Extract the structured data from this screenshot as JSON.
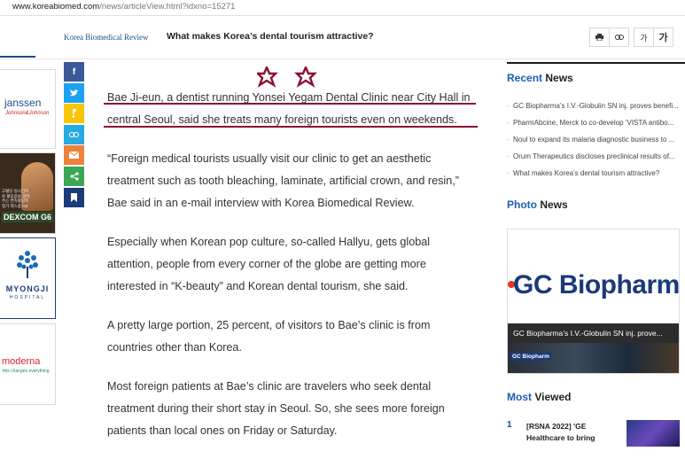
{
  "browser": {
    "url_host": "www.koreabiomed.com",
    "url_path": "/news/articleView.html?idxno=15271"
  },
  "header": {
    "brand": "Korea Biomedical Review",
    "headline": "What makes Korea’s dental tourism attractive?",
    "tools": {
      "print_icon": "printer-icon",
      "link_icon": "link-icon",
      "font_small": "가",
      "font_large": "가"
    }
  },
  "ads": {
    "janssen": {
      "name": "janssen",
      "sub": "Johnson&Johnson"
    },
    "dexcom": {
      "name": "DEXCOM G6",
      "blurb": "고혈당 실시간으로 혈당값을 알려주는 연속혈당측정기 덱스콤 G6"
    },
    "myongji": {
      "name": "MYONGJI",
      "sub": "HOSPITAL"
    },
    "moderna": {
      "name": "moderna",
      "sub": "this changes everything"
    }
  },
  "share": [
    {
      "icon": "facebook-icon",
      "label": "f",
      "color": "#3b5998"
    },
    {
      "icon": "twitter-icon",
      "label": "",
      "color": "#1da1f2"
    },
    {
      "icon": "kakaostory-icon",
      "label": "",
      "color": "#f7c600"
    },
    {
      "icon": "link-icon",
      "label": "",
      "color": "#27a9e1"
    },
    {
      "icon": "mail-icon",
      "label": "",
      "color": "#f0813a"
    },
    {
      "icon": "share-icon",
      "label": "",
      "color": "#3aa757"
    },
    {
      "icon": "bookmark-icon",
      "label": "",
      "color": "#1b3a7a"
    }
  ],
  "article": {
    "paragraphs": [
      "Bae Ji-eun, a dentist running Yonsei Yegam Dental Clinic near City Hall in central Seoul, said she treats many foreign tourists even on weekends.",
      "“Foreign medical tourists usually visit our clinic to get an aesthetic treatment such as tooth bleaching, laminate, artificial crown, and resin,” Bae said in an e-mail interview with Korea Biomedical Review.",
      "Especially when Korean pop culture, so-called Hallyu, gets global attention, people from every corner of the globe are getting more interested in “K-beauty” and Korean dental tourism, she said.",
      "A pretty large portion, 25 percent, of visitors to Bae’s clinic is from countries other than Korea.",
      "Most foreign patients at Bae’s clinic are travelers who seek dental treatment during their short stay in Seoul. So, she sees more foreign patients than local ones on Friday or Saturday."
    ]
  },
  "sidebar": {
    "recent": {
      "title_accent": "Recent",
      "title_rest": " News",
      "items": [
        "GC Biopharma’s I.V.-Globulin SN inj. proves benefi...",
        "PharmAbcine, Merck to co-develop ‘VISTA antibo...",
        "Noul to expand its malaria diagnostic business to ...",
        "Orum Therapeutics discloses preclinical results of...",
        "What makes Korea’s dental tourism attractive?"
      ]
    },
    "photo": {
      "title_accent": "Photo",
      "title_rest": " News",
      "logo": "GC Biopharm",
      "caption": "GC Biopharma’s I.V.-Globulin SN inj. prove...",
      "strip_logo": "GC Biopharm"
    },
    "most": {
      "title_accent": "Most",
      "title_rest": " Viewed",
      "items": [
        {
          "rank": "1",
          "text": "[RSNA 2022] 'GE Healthcare to bring"
        }
      ]
    }
  },
  "colors": {
    "accent": "#1a5fb4",
    "annotation": "#8c1030"
  }
}
